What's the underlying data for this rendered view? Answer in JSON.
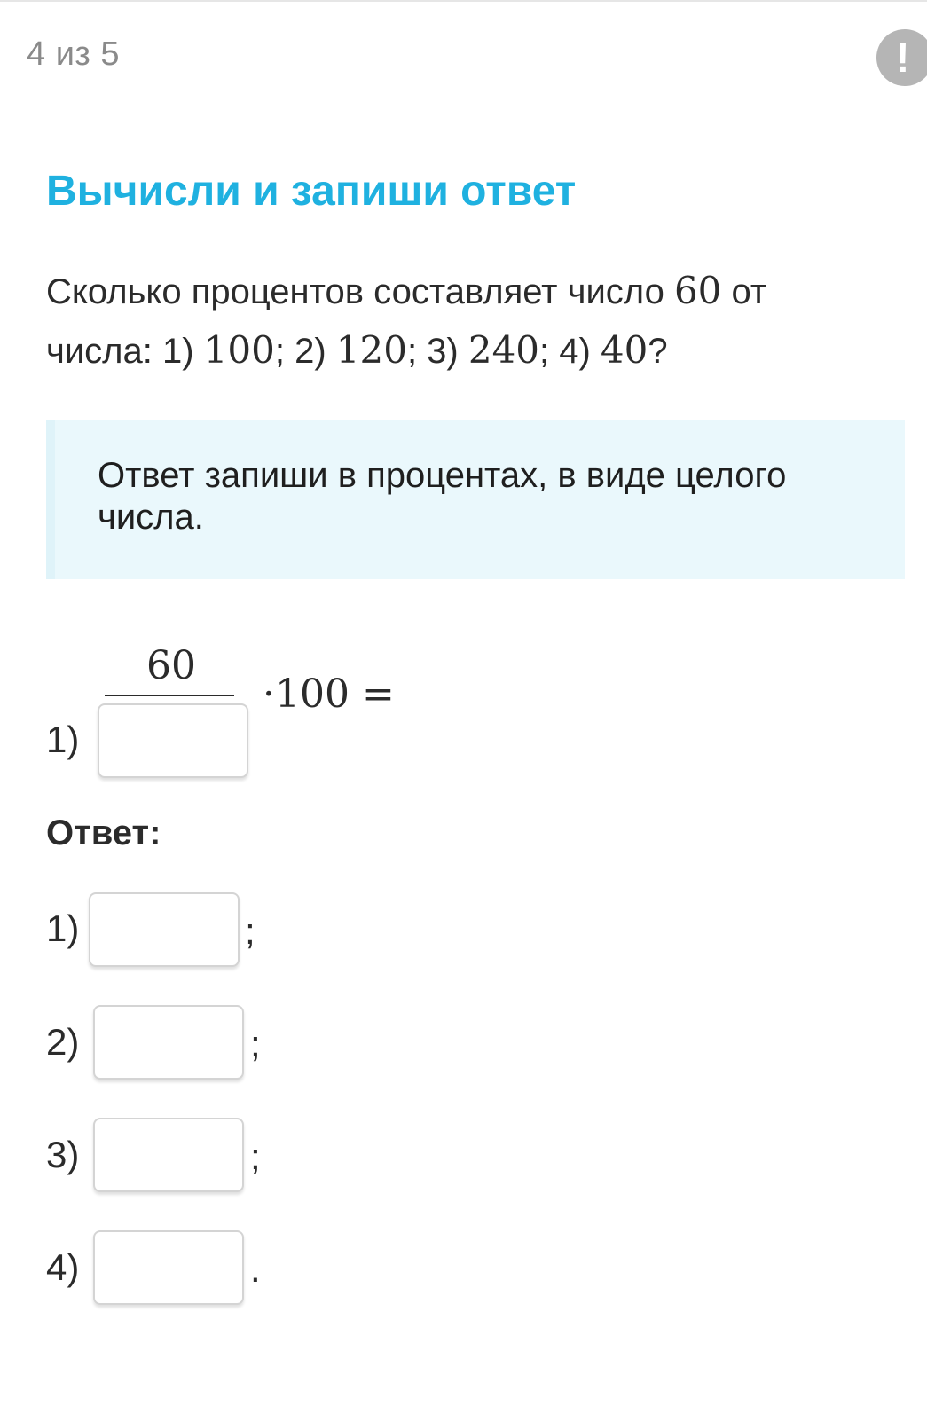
{
  "header": {
    "progress": "4 из 5",
    "report_icon_glyph": "!",
    "report_icon": "exclamation-circle-icon"
  },
  "task": {
    "title": "Вычисли и запиши ответ",
    "question": {
      "line1_text": "Сколько процентов составляет число ",
      "line1_num": "60",
      "line1_tail": " от",
      "line2_prefix": "числа: 1) ",
      "v1": "100",
      "sep1": "; 2) ",
      "v2": "120",
      "sep2": "; 3) ",
      "v3": "240",
      "sep3": "; 4) ",
      "v4": "40",
      "end": "?"
    },
    "hint": "Ответ запиши в процентах, в виде целого числа."
  },
  "solution": {
    "label": "1)",
    "numerator": "60",
    "rest": "·100 =",
    "denominator_value": ""
  },
  "answer": {
    "heading": "Ответ:",
    "items": [
      {
        "label": "1)",
        "value": "",
        "separator": ";"
      },
      {
        "label": "2)",
        "value": "",
        "separator": ";"
      },
      {
        "label": "3)",
        "value": "",
        "separator": ";"
      },
      {
        "label": "4)",
        "value": "",
        "separator": "."
      }
    ]
  },
  "colors": {
    "title": "#1fb1e0",
    "hint_bg": "#eaf8fc",
    "progress_text": "#8a8a8a",
    "report_button": "#b5b5b5"
  }
}
